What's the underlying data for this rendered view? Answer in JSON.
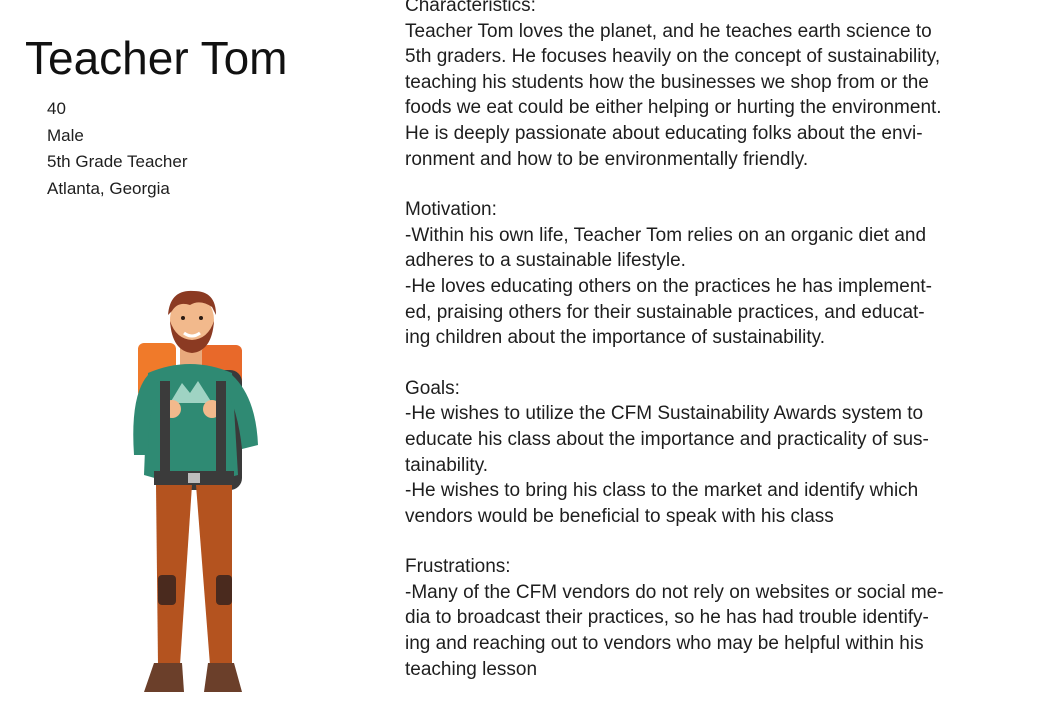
{
  "persona": {
    "name": "Teacher Tom",
    "facts": [
      "40",
      "Male",
      "5th Grade Teacher",
      "Atlanta, Georgia"
    ]
  },
  "sections": [
    {
      "title": "Characteristics:",
      "body": "Teacher Tom loves the planet, and he teaches earth science to\n5th graders. He focuses heavily on the concept of sustainability,\nteaching his students how the businesses we shop from or the\nfoods we eat could be either helping or hurting the environment.\nHe is deeply passionate about educating folks about the envi-\nronment and how to be environmentally friendly."
    },
    {
      "title": "Motivation:",
      "body": "-Within his own life, Teacher Tom relies on an organic diet and\nadheres to a sustainable lifestyle.\n-He loves educating others on the practices he has implement-\ned, praising others for their sustainable practices, and educat-\ning children about the importance of sustainability."
    },
    {
      "title": "Goals:",
      "body": "-He wishes to utilize the CFM Sustainability Awards system to\neducate his class about the importance and practicality of sus-\ntainability.\n-He wishes to bring his class to the market and identify which\nvendors would be beneficial to speak with his class"
    },
    {
      "title": "Frustrations:",
      "body": "-Many of the CFM vendors do not rely on websites or social me-\ndia to broadcast their practices, so he has had trouble identify-\ning and reaching out to vendors who may be helpful within his\nteaching lesson"
    }
  ],
  "illustration": {
    "icon": "hiker-teacher-illustration",
    "colors": {
      "hair": "#8b3a22",
      "skin": "#f2b98c",
      "sweater": "#2f8a73",
      "backpack": "#f07a2a",
      "pants": "#b4531f",
      "boots": "#6b3f2a",
      "straps": "#3b3b3b"
    }
  }
}
